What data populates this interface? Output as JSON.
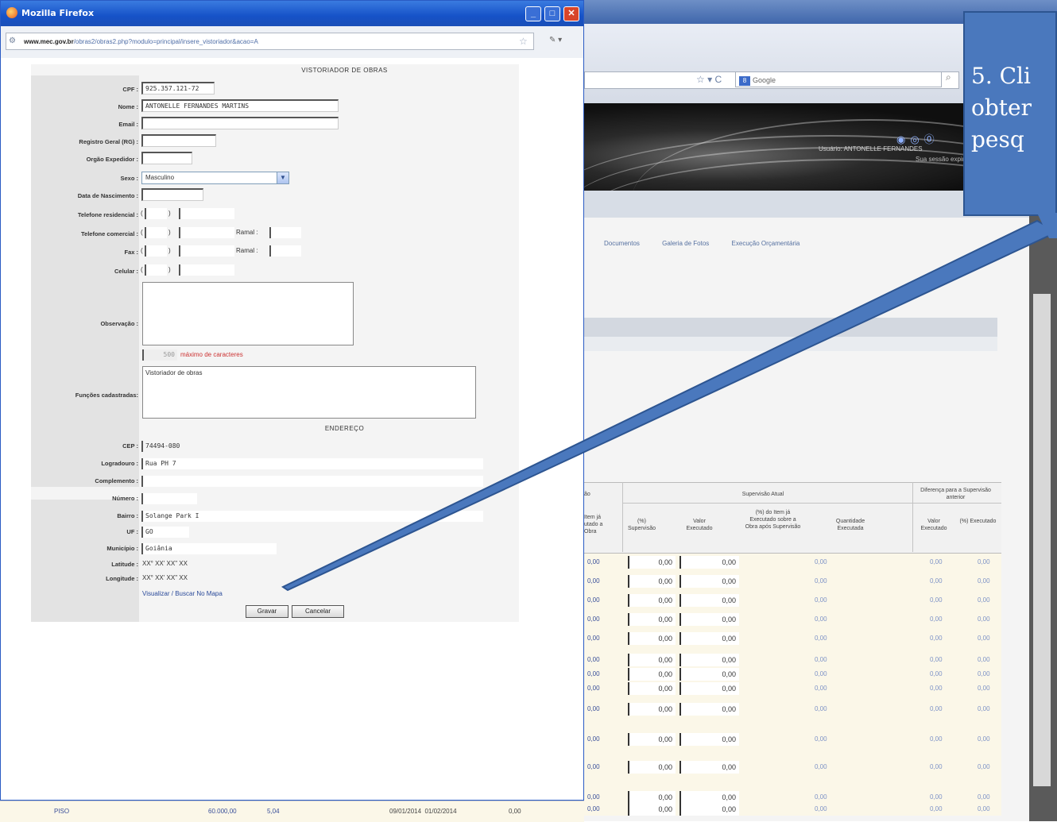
{
  "popup": {
    "window_title": "Mozilla Firefox",
    "url_domain": "www.mec.gov.br",
    "url_rest": "/obras2/obras2.php?modulo=principal/insere_vistoriador&acao=A",
    "form": {
      "section_title": "VISTORIADOR DE OBRAS",
      "cpf_label": "CPF :",
      "cpf_value": "925.357.121-72",
      "nome_label": "Nome :",
      "nome_value": "ANTONELLE FERNANDES MARTINS",
      "email_label": "Email :",
      "email_value": "",
      "rg_label": "Registro Geral (RG) :",
      "orgao_label": "Orgão Expedidor :",
      "sexo_label": "Sexo :",
      "sexo_value": "Masculino",
      "nascimento_label": "Data de Nascimento :",
      "tel_res_label": "Telefone residencial :",
      "tel_com_label": "Telefone comercial :",
      "fax_label": "Fax :",
      "celular_label": "Celular :",
      "ramal_label": "Ramal :",
      "ddd_open": "(",
      "ddd_close": ")",
      "obs_label": "Observação :",
      "obs_counter": "500",
      "obs_hint": "máximo de caracteres",
      "funcoes_label": "Funções cadastradas:",
      "funcoes_value": "Vistoriador de obras",
      "address_title": "ENDEREÇO",
      "cep_label": "CEP :",
      "cep_value": "74494-080",
      "logradouro_label": "Logradouro :",
      "logradouro_value": "Rua PH 7",
      "complemento_label": "Complemento :",
      "numero_label": "Número :",
      "bairro_label": "Bairro :",
      "bairro_value": "Solange Park I",
      "uf_label": "UF :",
      "uf_value": "GO",
      "municipio_label": "Município :",
      "municipio_value": "Goiânia",
      "latitude_label": "Latitude :",
      "latitude_value": "XX° XX' XX\" XX",
      "longitude_label": "Longitude :",
      "longitude_value": "XX° XX' XX\" XX",
      "map_link": "Visualizar / Buscar No Mapa",
      "save_button": "Gravar",
      "cancel_button": "Cancelar"
    }
  },
  "background": {
    "google_placeholder": "Google",
    "user_text": "Usuário: ANTONELLE FERNANDES",
    "session_text": "Sua sessão expira",
    "tabs": [
      "Documentos",
      "Galeria de Fotos",
      "Execução Orçamentária"
    ],
    "table": {
      "header_group_1": "Supervisão Atual",
      "header_group_2": "Diferença para a Supervisão anterior",
      "col_prev": "Item já utado a Obra",
      "col_pct": "(%) Supervisão",
      "col_valor": "Valor Executado",
      "col_pct_item": "(%) do Item já Executado sobre a Obra após Supervisão",
      "col_qtd": "Quantidade Executada",
      "col_diff_valor": "Valor Executado",
      "col_diff_pct": "(%) Executado",
      "col_partial": "ão",
      "rows": [
        {
          "a": "0,00",
          "b": "0,00",
          "c": "0,00",
          "d": "0,00",
          "e": "0,00",
          "f": "0,00"
        },
        {
          "a": "0,00",
          "b": "0,00",
          "c": "0,00",
          "d": "0,00",
          "e": "0,00",
          "f": "0,00"
        },
        {
          "a": "0,00",
          "b": "0,00",
          "c": "0,00",
          "d": "0,00",
          "e": "0,00",
          "f": "0,00"
        },
        {
          "a": "0,00",
          "b": "0,00",
          "c": "0,00",
          "d": "0,00",
          "e": "0,00",
          "f": "0,00"
        },
        {
          "a": "0,00",
          "b": "0,00",
          "c": "0,00",
          "d": "0,00",
          "e": "0,00",
          "f": "0,00"
        },
        {
          "a": "0,00",
          "b": "0,00",
          "c": "0,00",
          "d": "0,00",
          "e": "0,00",
          "f": "0,00"
        },
        {
          "a": "0,00",
          "b": "0,00",
          "c": "0,00",
          "d": "0,00",
          "e": "0,00",
          "f": "0,00"
        },
        {
          "a": "0,00",
          "b": "0,00",
          "c": "0,00",
          "d": "0,00",
          "e": "0,00",
          "f": "0,00"
        },
        {
          "a": "0,00",
          "b": "0,00",
          "c": "0,00",
          "d": "0,00",
          "e": "0,00",
          "f": "0,00"
        },
        {
          "a": "0,00",
          "b": "0,00",
          "c": "0,00",
          "d": "0,00",
          "e": "0,00",
          "f": "0,00"
        },
        {
          "a": "0,00",
          "b": "0,00",
          "c": "0,00",
          "d": "0,00",
          "e": "0,00",
          "f": "0,00"
        },
        {
          "a": "0,00",
          "b": "0,00",
          "c": "0,00",
          "d": "0,00",
          "e": "0,00",
          "f": "0,00"
        },
        {
          "a": "0,00",
          "b": "0,00",
          "c": "0,00",
          "d": "0,00",
          "e": "0,00",
          "f": "0,00"
        }
      ]
    },
    "bottom_row": {
      "name": "PISO",
      "v1": "60.000,00",
      "v2": "5,04",
      "dates": "09/01/2014  01/02/2014",
      "v3": "0,00"
    }
  },
  "callout": {
    "text": "5. Cli\nobter\npesq"
  }
}
